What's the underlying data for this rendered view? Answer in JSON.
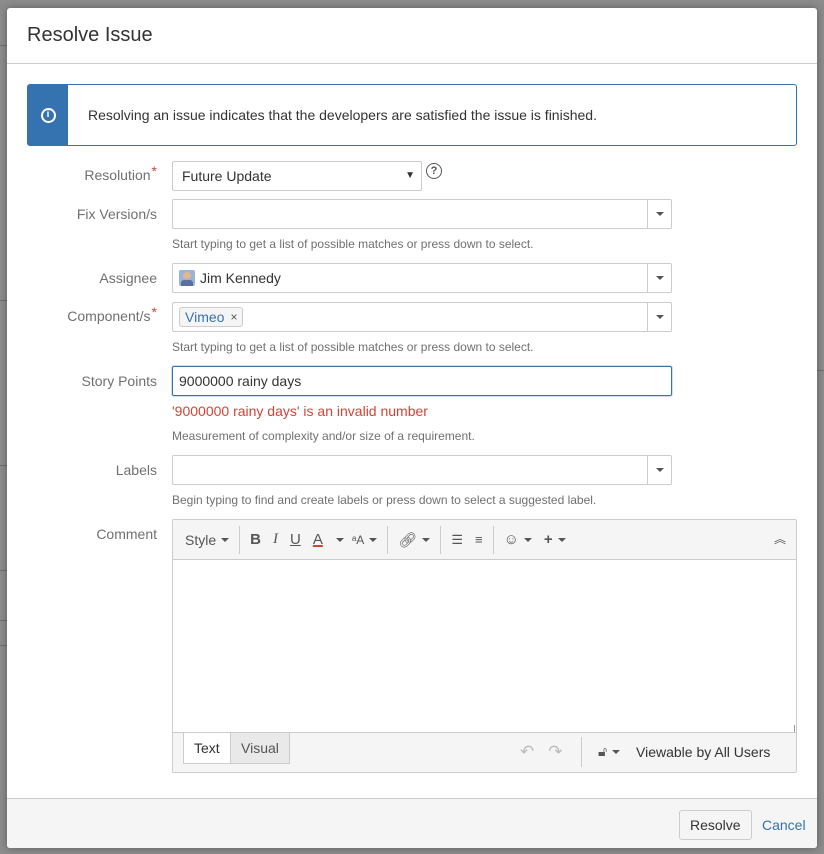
{
  "dialog": {
    "title": "Resolve Issue",
    "info_message": "Resolving an issue indicates that the developers are satisfied the issue is finished."
  },
  "fields": {
    "resolution": {
      "label": "Resolution",
      "value": "Future Update"
    },
    "fix_version": {
      "label": "Fix Version/s",
      "value": "",
      "description": "Start typing to get a list of possible matches or press down to select."
    },
    "assignee": {
      "label": "Assignee",
      "value": "Jim Kennedy"
    },
    "components": {
      "label": "Component/s",
      "chips": [
        "Vimeo"
      ],
      "description": "Start typing to get a list of possible matches or press down to select."
    },
    "story_points": {
      "label": "Story Points",
      "value": "9000000 rainy days",
      "error": "'9000000 rainy days' is an invalid number",
      "description": "Measurement of complexity and/or size of a requirement."
    },
    "labels": {
      "label": "Labels",
      "value": "",
      "description": "Begin typing to find and create labels or press down to select a suggested label."
    },
    "comment": {
      "label": "Comment"
    }
  },
  "editor": {
    "style_label": "Style",
    "tabs": {
      "text": "Text",
      "visual": "Visual"
    },
    "visibility": "Viewable by All Users"
  },
  "footer": {
    "resolve_label": "Resolve",
    "cancel_label": "Cancel"
  },
  "colors": {
    "accent": "#3572b0",
    "error": "#d04437"
  }
}
